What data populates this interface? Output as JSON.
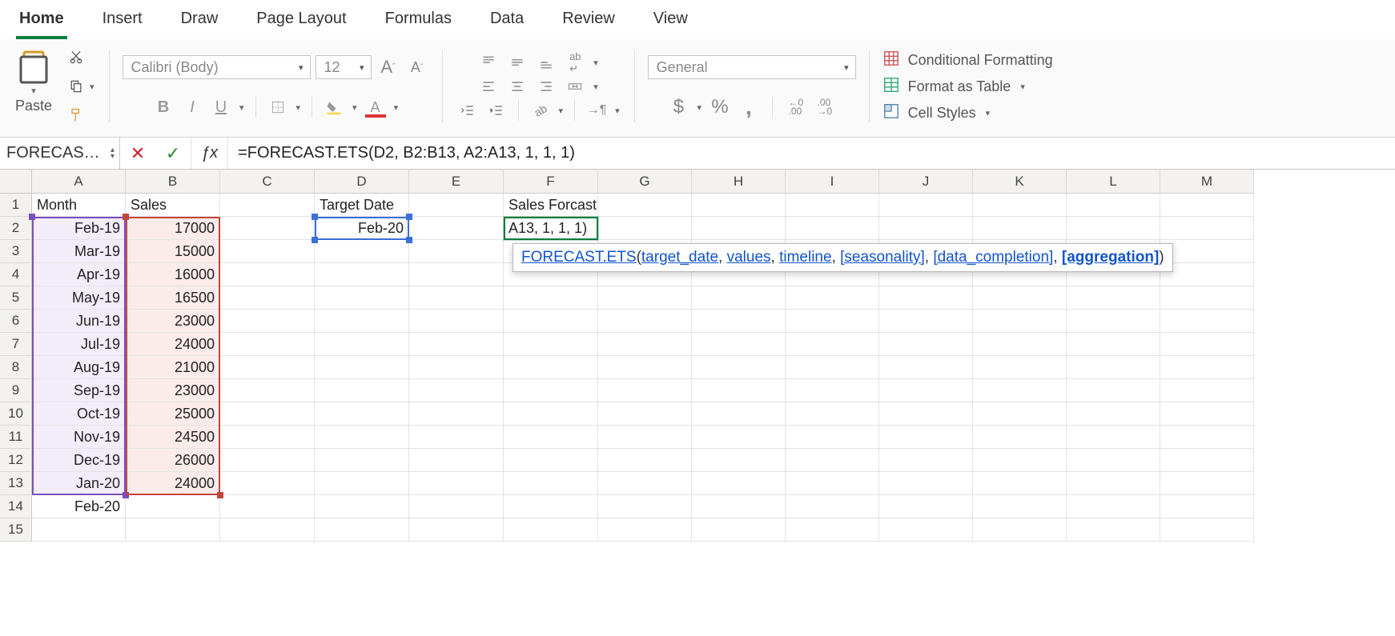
{
  "ribbon_tabs": [
    "Home",
    "Insert",
    "Draw",
    "Page Layout",
    "Formulas",
    "Data",
    "Review",
    "View"
  ],
  "active_tab_index": 0,
  "paste_label": "Paste",
  "font": {
    "name": "Calibri (Body)",
    "size": "12"
  },
  "number_format": "General",
  "styles": {
    "cond_fmt": "Conditional Formatting",
    "format_table": "Format as Table",
    "cell_styles": "Cell Styles"
  },
  "percent_sign": "%",
  "comma_sign": ",",
  "currency_sign": "$",
  "dec_inc": ".0",
  "dec_inc_sub": ".00",
  "dec_dec": ".00",
  "dec_dec_sub": "→0",
  "name_box": "FORECAS…",
  "formula": "=FORECAST.ETS(D2, B2:B13, A2:A13, 1, 1, 1)",
  "columns": [
    "A",
    "B",
    "C",
    "D",
    "E",
    "F",
    "G",
    "H",
    "I",
    "J",
    "K",
    "L",
    "M"
  ],
  "row_count": 15,
  "headers": {
    "A1": "Month",
    "B1": "Sales",
    "D1": "Target Date",
    "F1": "Sales Forcast"
  },
  "data_A": [
    "Feb-19",
    "Mar-19",
    "Apr-19",
    "May-19",
    "Jun-19",
    "Jul-19",
    "Aug-19",
    "Sep-19",
    "Oct-19",
    "Nov-19",
    "Dec-19",
    "Jan-20",
    "Feb-20"
  ],
  "data_B": [
    "17000",
    "15000",
    "16000",
    "16500",
    "23000",
    "24000",
    "21000",
    "23000",
    "25000",
    "24500",
    "26000",
    "24000"
  ],
  "D2": "Feb-20",
  "F2_display": "A13, 1, 1, 1)",
  "tooltip": {
    "fn": "FORECAST.ETS",
    "args": [
      "target_date",
      "values",
      "timeline",
      "[seasonality]",
      "[data_completion]",
      "[aggregation]"
    ],
    "active_arg_index": 5
  }
}
